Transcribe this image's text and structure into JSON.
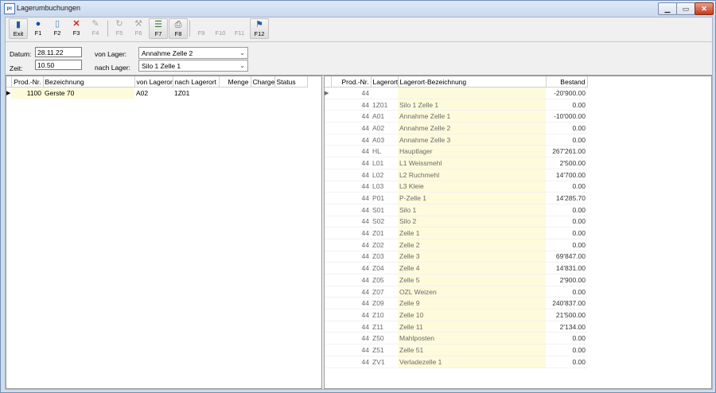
{
  "window": {
    "title": "Lagerumbuchungen",
    "icon_text": "pc",
    "controls": [
      "minimize",
      "maximize",
      "close"
    ]
  },
  "toolbar": {
    "buttons": [
      {
        "label": "Exit",
        "icon": "exit-icon",
        "enabled": true
      },
      {
        "label": "F1",
        "icon": "help-icon",
        "enabled": true
      },
      {
        "label": "F2",
        "icon": "new-document-icon",
        "enabled": true
      },
      {
        "label": "F3",
        "icon": "delete-icon",
        "enabled": true
      },
      {
        "label": "F4",
        "icon": "edit-icon",
        "enabled": false
      },
      {
        "label": "F5",
        "icon": "refresh-icon",
        "enabled": false
      },
      {
        "label": "F6",
        "icon": "tools-icon",
        "enabled": false
      },
      {
        "label": "F7",
        "icon": "list-icon",
        "enabled": true
      },
      {
        "label": "F8",
        "icon": "print-icon",
        "enabled": true
      },
      {
        "label": "F9",
        "icon": "",
        "enabled": false
      },
      {
        "label": "F10",
        "icon": "",
        "enabled": false
      },
      {
        "label": "F11",
        "icon": "",
        "enabled": false
      },
      {
        "label": "F12",
        "icon": "options-icon",
        "enabled": true
      }
    ]
  },
  "form": {
    "datum_label": "Datum:",
    "datum_value": "28.11.22",
    "zeit_label": "Zeit:",
    "zeit_value": "10.50",
    "von_lager_label": "von Lager:",
    "von_lager_value": "Annahme Zelle 2",
    "nach_lager_label": "nach Lager:",
    "nach_lager_value": "Silo 1 Zelle 1"
  },
  "left_table": {
    "columns": [
      "Prod.-Nr.",
      "Bezeichnung",
      "von Lagerort",
      "nach Lagerort",
      "Menge",
      "Charge",
      "Status"
    ],
    "rows": [
      {
        "prod_nr": "1100",
        "bezeichnung": "Gerste 70",
        "von": "A02",
        "nach": "1Z01",
        "menge": "",
        "charge": "",
        "status": ""
      }
    ]
  },
  "right_table": {
    "columns": [
      "Prod.-Nr.",
      "Lagerort",
      "Lagerort-Bezeichnung",
      "Bestand"
    ],
    "rows": [
      {
        "prod_nr": "44",
        "lagerort": "",
        "bez": "",
        "bestand": "-20'900.00"
      },
      {
        "prod_nr": "44",
        "lagerort": "1Z01",
        "bez": "Silo 1 Zelle 1",
        "bestand": "0.00"
      },
      {
        "prod_nr": "44",
        "lagerort": "A01",
        "bez": "Annahme Zelle 1",
        "bestand": "-10'000.00"
      },
      {
        "prod_nr": "44",
        "lagerort": "A02",
        "bez": "Annahme Zelle 2",
        "bestand": "0.00"
      },
      {
        "prod_nr": "44",
        "lagerort": "A03",
        "bez": "Annahme Zelle 3",
        "bestand": "0.00"
      },
      {
        "prod_nr": "44",
        "lagerort": "HL",
        "bez": "Hauptlager",
        "bestand": "267'261.00"
      },
      {
        "prod_nr": "44",
        "lagerort": "L01",
        "bez": "L1 Weissmehl",
        "bestand": "2'500.00"
      },
      {
        "prod_nr": "44",
        "lagerort": "L02",
        "bez": "L2 Ruchmehl",
        "bestand": "14'700.00"
      },
      {
        "prod_nr": "44",
        "lagerort": "L03",
        "bez": "L3 Kleie",
        "bestand": "0.00"
      },
      {
        "prod_nr": "44",
        "lagerort": "P01",
        "bez": "P-Zelle 1",
        "bestand": "14'285.70"
      },
      {
        "prod_nr": "44",
        "lagerort": "S01",
        "bez": "Silo 1",
        "bestand": "0.00"
      },
      {
        "prod_nr": "44",
        "lagerort": "S02",
        "bez": "Silo 2",
        "bestand": "0.00"
      },
      {
        "prod_nr": "44",
        "lagerort": "Z01",
        "bez": "Zelle 1",
        "bestand": "0.00"
      },
      {
        "prod_nr": "44",
        "lagerort": "Z02",
        "bez": "Zelle 2",
        "bestand": "0.00"
      },
      {
        "prod_nr": "44",
        "lagerort": "Z03",
        "bez": "Zelle 3",
        "bestand": "69'847.00"
      },
      {
        "prod_nr": "44",
        "lagerort": "Z04",
        "bez": "Zelle 4",
        "bestand": "14'831.00"
      },
      {
        "prod_nr": "44",
        "lagerort": "Z05",
        "bez": "Zelle 5",
        "bestand": "2'900.00"
      },
      {
        "prod_nr": "44",
        "lagerort": "Z07",
        "bez": "OZL Weizen",
        "bestand": "0.00"
      },
      {
        "prod_nr": "44",
        "lagerort": "Z09",
        "bez": "Zelle 9",
        "bestand": "240'837.00"
      },
      {
        "prod_nr": "44",
        "lagerort": "Z10",
        "bez": "Zelle 10",
        "bestand": "21'500.00"
      },
      {
        "prod_nr": "44",
        "lagerort": "Z11",
        "bez": "Zelle 11",
        "bestand": "2'134.00"
      },
      {
        "prod_nr": "44",
        "lagerort": "Z50",
        "bez": "Mahlposten",
        "bestand": "0.00"
      },
      {
        "prod_nr": "44",
        "lagerort": "Z51",
        "bez": "Zelle 51",
        "bestand": "0.00"
      },
      {
        "prod_nr": "44",
        "lagerort": "ZV1",
        "bez": "Verladezelle 1",
        "bestand": "0.00"
      }
    ]
  },
  "colors": {
    "description_highlight": "#fdfbdb",
    "title_bar": "#cfdcec",
    "close_button": "#c43a1c"
  }
}
